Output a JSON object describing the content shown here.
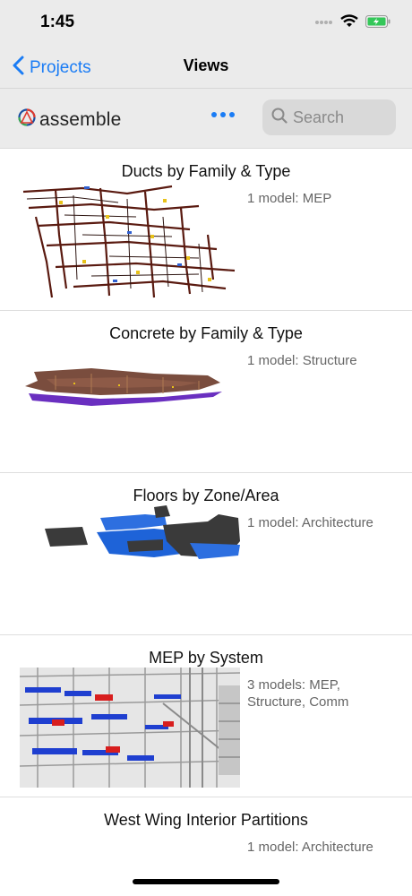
{
  "status": {
    "time": "1:45"
  },
  "nav": {
    "back_label": "Projects",
    "title": "Views"
  },
  "toolbar": {
    "logo_text": "assemble",
    "more_icon": "more-icon",
    "search_placeholder": "Search"
  },
  "views": [
    {
      "title": "Ducts by Family & Type",
      "models": "1 model: MEP"
    },
    {
      "title": "Concrete by Family & Type",
      "models": "1 model: Structure"
    },
    {
      "title": "Floors by Zone/Area",
      "models": "1 model: Architecture"
    },
    {
      "title": "MEP by System",
      "models": "3 models: MEP, Structure, Comm"
    },
    {
      "title": "West Wing Interior Partitions",
      "models": "1 model: Architecture"
    }
  ],
  "colors": {
    "accent": "#1a7cf5",
    "header_bg": "#ebebeb",
    "battery": "#34c759"
  }
}
